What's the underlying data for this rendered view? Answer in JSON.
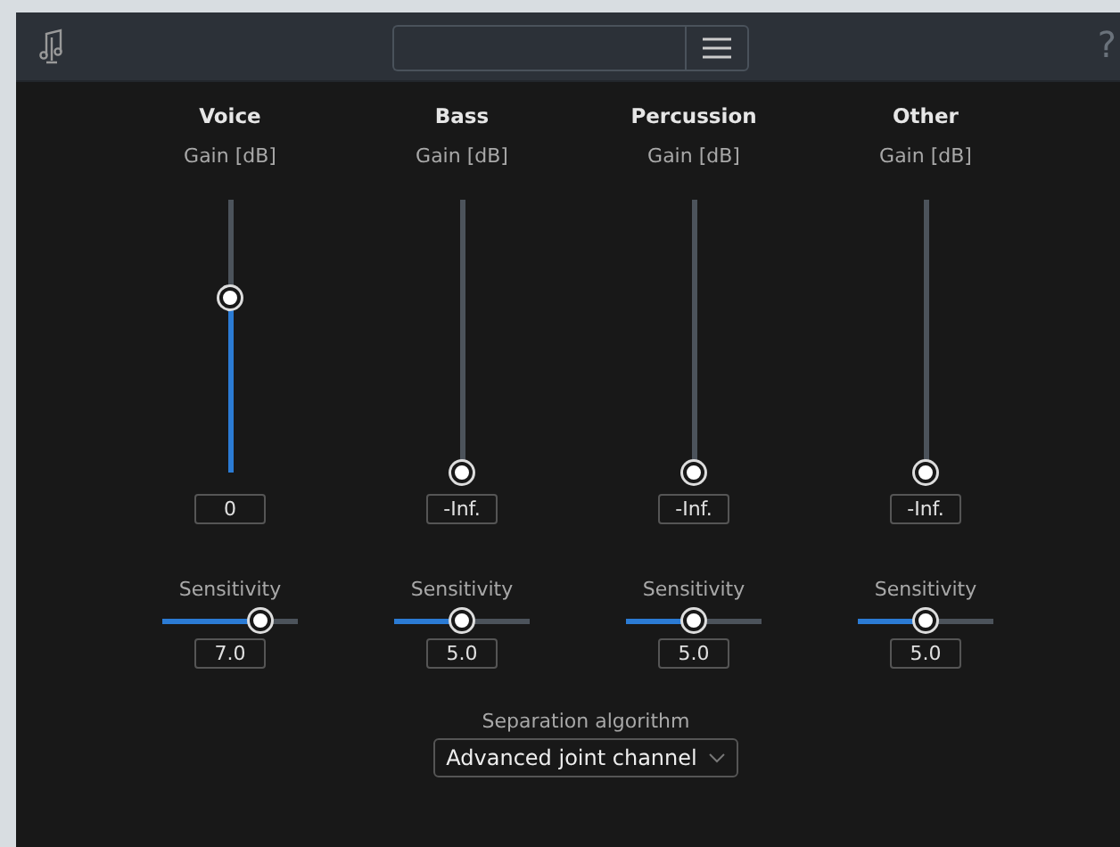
{
  "channels": [
    {
      "name": "Voice",
      "gain": {
        "label": "Gain [dB]",
        "level": 0.64,
        "value": "0"
      },
      "sensitivity": {
        "label": "Sensitivity",
        "level": 0.72,
        "value": "7.0"
      }
    },
    {
      "name": "Bass",
      "gain": {
        "label": "Gain [dB]",
        "level": 0,
        "value": "-Inf."
      },
      "sensitivity": {
        "label": "Sensitivity",
        "level": 0.5,
        "value": "5.0"
      }
    },
    {
      "name": "Percussion",
      "gain": {
        "label": "Gain [dB]",
        "level": 0,
        "value": "-Inf."
      },
      "sensitivity": {
        "label": "Sensitivity",
        "level": 0.5,
        "value": "5.0"
      }
    },
    {
      "name": "Other",
      "gain": {
        "label": "Gain [dB]",
        "level": 0,
        "value": "-Inf."
      },
      "sensitivity": {
        "label": "Sensitivity",
        "level": 0.5,
        "value": "5.0"
      }
    }
  ],
  "algorithm": {
    "label": "Separation algorithm",
    "value": "Advanced joint channel"
  },
  "help": "?"
}
